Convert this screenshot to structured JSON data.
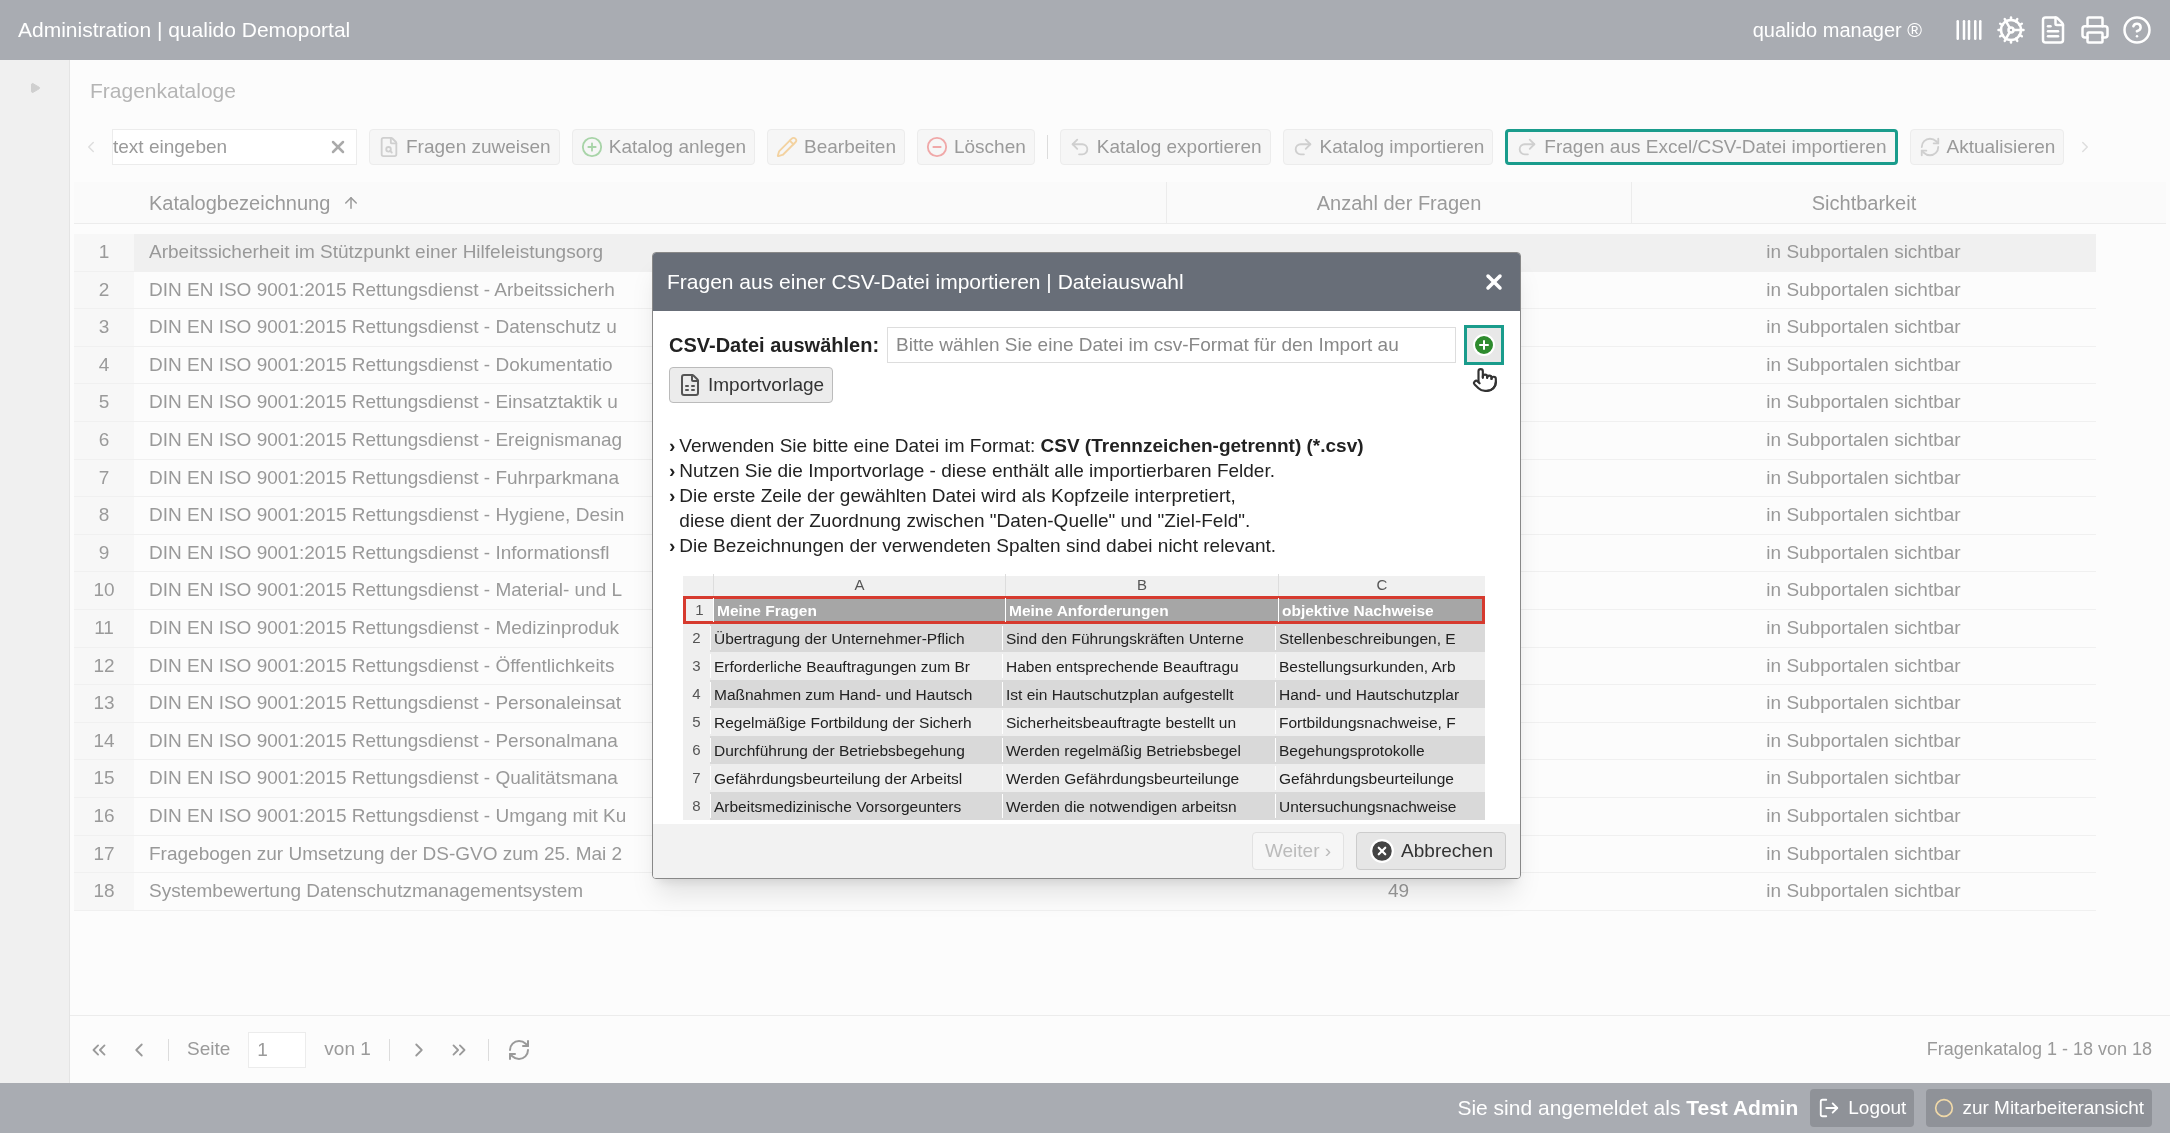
{
  "header": {
    "title": "Administration | qualido Demoportal",
    "product": "qualido manager ®"
  },
  "page_title": "Fragenkataloge",
  "toolbar": {
    "search": {
      "placeholder": "text eingeben"
    },
    "buttons": [
      {
        "kind": "assign",
        "label": "Fragen zuweisen",
        "highlighted": false
      },
      {
        "kind": "add",
        "label": "Katalog anlegen",
        "highlighted": false
      },
      {
        "kind": "edit",
        "label": "Bearbeiten",
        "highlighted": false
      },
      {
        "kind": "delete",
        "label": "Löschen",
        "highlighted": false
      },
      {
        "kind": "export",
        "label": "Katalog exportieren",
        "highlighted": false
      },
      {
        "kind": "import",
        "label": "Katalog importieren",
        "highlighted": false
      },
      {
        "kind": "import",
        "label": "Fragen aus Excel/CSV-Datei importieren",
        "highlighted": true
      },
      {
        "kind": "refresh",
        "label": "Aktualisieren",
        "highlighted": false
      }
    ]
  },
  "table": {
    "columns": [
      "Katalogbezeichnung",
      "Anzahl der Fragen",
      "Sichtbarkeit"
    ],
    "rows": [
      {
        "number": "1",
        "name": "Arbeitssicherheit im Stützpunkt einer Hilfeleistungsorg",
        "visibility": "in Subportalen sichtbar",
        "selected": true
      },
      {
        "number": "2",
        "name": "DIN EN ISO 9001:2015 Rettungsdienst - Arbeitssicherh",
        "visibility": "in Subportalen sichtbar",
        "selected": false
      },
      {
        "number": "3",
        "name": "DIN EN ISO 9001:2015 Rettungsdienst - Datenschutz u",
        "visibility": "in Subportalen sichtbar",
        "selected": false
      },
      {
        "number": "4",
        "name": "DIN EN ISO 9001:2015 Rettungsdienst - Dokumentatio",
        "visibility": "in Subportalen sichtbar",
        "selected": false
      },
      {
        "number": "5",
        "name": "DIN EN ISO 9001:2015 Rettungsdienst - Einsatztaktik u",
        "visibility": "in Subportalen sichtbar",
        "selected": false
      },
      {
        "number": "6",
        "name": "DIN EN ISO 9001:2015 Rettungsdienst - Ereignismanag",
        "visibility": "in Subportalen sichtbar",
        "selected": false
      },
      {
        "number": "7",
        "name": "DIN EN ISO 9001:2015 Rettungsdienst - Fuhrparkmana",
        "visibility": "in Subportalen sichtbar",
        "selected": false
      },
      {
        "number": "8",
        "name": "DIN EN ISO 9001:2015 Rettungsdienst - Hygiene, Desin",
        "visibility": "in Subportalen sichtbar",
        "selected": false
      },
      {
        "number": "9",
        "name": "DIN EN ISO 9001:2015 Rettungsdienst - Informationsfl",
        "visibility": "in Subportalen sichtbar",
        "selected": false
      },
      {
        "number": "10",
        "name": "DIN EN ISO 9001:2015 Rettungsdienst - Material- und L",
        "visibility": "in Subportalen sichtbar",
        "selected": false
      },
      {
        "number": "11",
        "name": "DIN EN ISO 9001:2015 Rettungsdienst - Medizinproduk",
        "visibility": "in Subportalen sichtbar",
        "selected": false
      },
      {
        "number": "12",
        "name": "DIN EN ISO 9001:2015 Rettungsdienst - Öffentlichkeits",
        "visibility": "in Subportalen sichtbar",
        "selected": false
      },
      {
        "number": "13",
        "name": "DIN EN ISO 9001:2015 Rettungsdienst - Personaleinsat",
        "visibility": "in Subportalen sichtbar",
        "selected": false
      },
      {
        "number": "14",
        "name": "DIN EN ISO 9001:2015 Rettungsdienst - Personalmana",
        "visibility": "in Subportalen sichtbar",
        "selected": false
      },
      {
        "number": "15",
        "name": "DIN EN ISO 9001:2015 Rettungsdienst - Qualitätsmana",
        "visibility": "in Subportalen sichtbar",
        "selected": false
      },
      {
        "number": "16",
        "name": "DIN EN ISO 9001:2015 Rettungsdienst - Umgang mit Ku",
        "visibility": "in Subportalen sichtbar",
        "selected": false
      },
      {
        "number": "17",
        "name": "Fragebogen zur Umsetzung der DS-GVO zum 25. Mai 2",
        "visibility": "in Subportalen sichtbar",
        "selected": false
      },
      {
        "number": "18",
        "name": "Systembewertung Datenschutzmanagementsystem",
        "count": "49",
        "visibility": "in Subportalen sichtbar",
        "selected": false
      }
    ]
  },
  "pagination": {
    "page_label": "Seite",
    "page": "1",
    "of": "von 1",
    "summary": "Fragenkatalog 1 - 18 von 18"
  },
  "status_bar": {
    "login": "Sie sind angemeldet als **Test Admin**",
    "buttons": [
      {
        "kind": "logout",
        "label": "Logout"
      },
      {
        "kind": "employee",
        "label": "zur Mitarbeiteransicht"
      }
    ]
  },
  "dialog": {
    "title": "Fragen aus einer CSV-Datei importieren | Dateiauswahl",
    "file_label": "CSV-Datei auswählen:",
    "file_placeholder": "Bitte wählen Sie eine Datei im csv-Format für den Import au",
    "template_button": "Importvorlage",
    "bullet": "›",
    "instructions": [
      [
        "Verwenden Sie bitte eine Datei im Format: **CSV (Trennzeichen-getrennt) (*.csv)**"
      ],
      [
        "Nutzen Sie die Importvorlage - diese enthält alle importierbaren Felder."
      ],
      [
        "Die erste Zeile der gewählten Datei wird als Kopfzeile interpretiert,",
        "diese dient der Zuordnung zwischen \"Daten-Quelle\" und \"Ziel-Feld\"."
      ],
      [
        "Die Bezeichnungen der verwendeten Spalten sind dabei nicht relevant."
      ]
    ],
    "sheet": {
      "columns": [
        "A",
        "B",
        "C"
      ],
      "rows": [
        {
          "number": "1",
          "cells": [
            "Meine Fragen",
            "Meine Anforderungen",
            "objektive Nachweise"
          ],
          "highlighted": true
        },
        {
          "number": "2",
          "cells": [
            "Übertragung der Unternehmer-Pflich",
            "Sind den Führungskräften Unterne",
            "Stellenbeschreibungen, E"
          ],
          "highlighted": false
        },
        {
          "number": "3",
          "cells": [
            "Erforderliche Beauftragungen zum Br",
            "Haben entsprechende Beauftragu",
            "Bestellungsurkunden, Arb"
          ],
          "highlighted": false
        },
        {
          "number": "4",
          "cells": [
            "Maßnahmen zum Hand- und Hautsch",
            "Ist ein Hautschutzplan aufgestellt",
            "Hand- und Hautschutzplar"
          ],
          "highlighted": false
        },
        {
          "number": "5",
          "cells": [
            "Regelmäßige Fortbildung der Sicherh",
            "Sicherheitsbeauftragte bestellt un",
            "Fortbildungsnachweise, F"
          ],
          "highlighted": false
        },
        {
          "number": "6",
          "cells": [
            "Durchführung der Betriebsbegehung",
            "Werden regelmäßig Betriebsbegel",
            "Begehungsprotokolle"
          ],
          "highlighted": false
        },
        {
          "number": "7",
          "cells": [
            "Gefährdungsbeurteilung der Arbeitsl",
            "Werden Gefährdungsbeurteilunge",
            "Gefährdungsbeurteilunge"
          ],
          "highlighted": false
        },
        {
          "number": "8",
          "cells": [
            "Arbeitsmedizinische Vorsorgeunters",
            "Werden die notwendigen arbeitsn",
            "Untersuchungsnachweise"
          ],
          "highlighted": false
        }
      ]
    },
    "buttons": [
      {
        "kind": "next",
        "label": "Weiter ›",
        "disabled": true
      },
      {
        "kind": "cancel",
        "label": "Abbrechen",
        "disabled": false
      }
    ]
  }
}
